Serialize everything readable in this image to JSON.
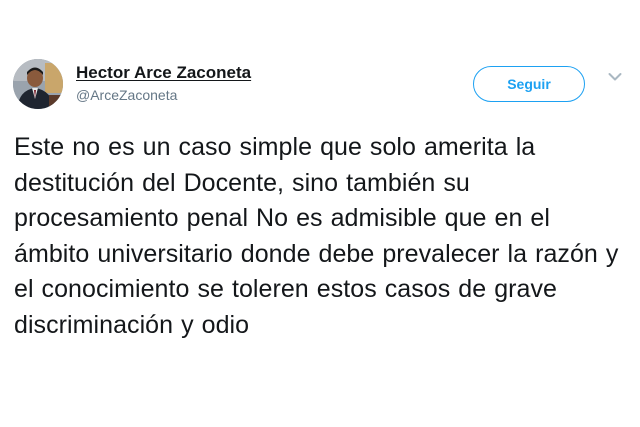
{
  "author": {
    "display_name": "Hector Arce Zaconeta",
    "handle": "@ArceZaconeta",
    "avatar_icon": "profile-photo"
  },
  "follow_button": {
    "label": "Seguir",
    "color": "#1da1f2"
  },
  "menu": {
    "icon": "chevron-down-icon"
  },
  "tweet": {
    "text": "Este no es un caso simple que solo amerita la destitución del Docente, sino también su procesamiento penal No es admisible que en el ámbito universitario donde debe prevalecer la razón y el conocimiento se toleren estos casos de grave discriminación y odio"
  }
}
